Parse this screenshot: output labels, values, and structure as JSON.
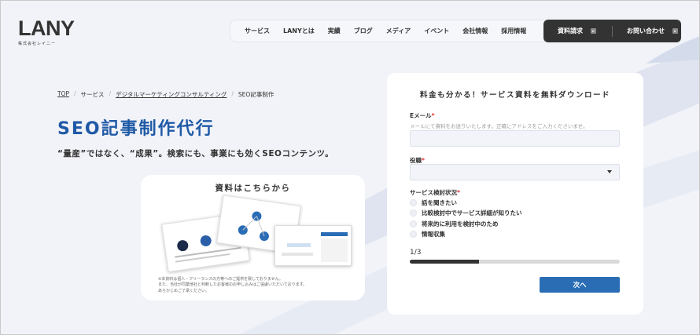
{
  "header": {
    "logo": "LANY",
    "logo_sub": "株式会社レイニー",
    "nav": [
      "サービス",
      "LANYとは",
      "実績",
      "ブログ",
      "メディア",
      "イベント",
      "会社情報",
      "採用情報"
    ],
    "cta": [
      {
        "label": "資料請求"
      },
      {
        "label": "お問い合わせ"
      }
    ]
  },
  "breadcrumb": [
    "TOP",
    "サービス",
    "デジタルマーケティングコンサルティング",
    "SEO記事制作"
  ],
  "breadcrumb_sep": "/",
  "hero": {
    "title": "SEO記事制作代行",
    "subtitle": "“量産”ではなく、“成果”。検索にも、事業にも効くSEOコンテンツ。"
  },
  "doc_card": {
    "title": "資料はこちらから",
    "note": [
      "※本資料は個人・フリーランスの方等へのご提供を致しておりません。",
      "また、当社が同業他社と判断したお客様のお申し込みはご遠慮いただいております。",
      "あらかじめご了承ください。"
    ]
  },
  "form": {
    "title": "料金も分かる！サービス資料を無料ダウンロード",
    "required_mark": "*",
    "email_label": "Eメール",
    "email_hint": "メールにて資料をお送りいたします。正確にアドレスをご入力くださいませ。",
    "email_value": "",
    "role_label": "役職",
    "role_value": "",
    "status_label": "サービス検討状況",
    "options": [
      "話を聞きたい",
      "比較検討中でサービス詳細が知りたい",
      "将来的に利用を検討中のため",
      "情報収集"
    ],
    "step": "1/3",
    "progress": 0.33,
    "next": "次へ"
  },
  "colors": {
    "accent": "#1f5aa6",
    "button": "#2a6db5",
    "dark": "#333333"
  }
}
